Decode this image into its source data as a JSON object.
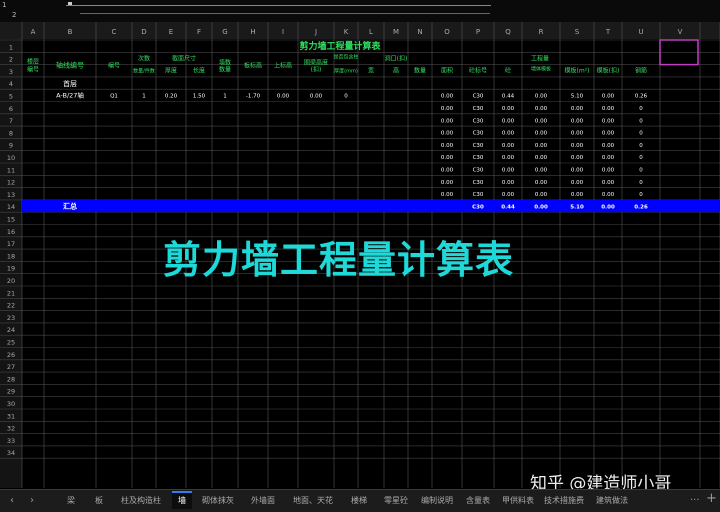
{
  "toolbar": {
    "levels": [
      "1",
      "2"
    ]
  },
  "sheet": {
    "col_letters": [
      "A",
      "B",
      "C",
      "D",
      "E",
      "F",
      "G",
      "H",
      "I",
      "J",
      "K",
      "L",
      "M",
      "N",
      "O",
      "P",
      "Q",
      "R",
      "S",
      "T",
      "U",
      "V"
    ],
    "title": "剪力墙工程量计算表",
    "headers": {
      "floor_no": "楼层编号",
      "axis_no": "轴线编号",
      "code": "编号",
      "count": "次数",
      "count_sub": "数量/件数",
      "section": "截面尺寸",
      "thick": "厚度",
      "height": "长度",
      "wall_count": "墙数/数量",
      "floor_h": "板标高",
      "top_h": "上标高",
      "ring_h": "圈梁高度(扣)",
      "misc": "是否包含柱",
      "misc_sub": "厚度(mm)",
      "opening": "洞口(扣)",
      "op_w": "宽",
      "op_h": "高",
      "op_n": "数量",
      "op_area": "面积",
      "quantities": "工程量",
      "q_grade": "砼标号",
      "q_conc": "砼",
      "q_edge": "墙体模板",
      "q_form": "模板(m²)",
      "q_form2": "模板(扣)",
      "q_rebar": "钢筋"
    },
    "floor_label": "首层",
    "rows": [
      {
        "axis": "A-B/27轴",
        "code": "Q1",
        "count": "1",
        "thick": "0.20",
        "height": "1.50",
        "wall": "1",
        "floor_h": "-1.70",
        "top_h": "0.00",
        "ring": "0.00",
        "misc": "0",
        "area": "0.00",
        "grade": "C30",
        "conc": "0.44",
        "edge": "0.00",
        "form": "5.10",
        "form2": "0.00",
        "rebar": "0.26"
      },
      {
        "area": "0.00",
        "grade": "C30",
        "conc": "0.00",
        "edge": "0.00",
        "form": "0.00",
        "form2": "0.00",
        "rebar": "0"
      },
      {
        "area": "0.00",
        "grade": "C30",
        "conc": "0.00",
        "edge": "0.00",
        "form": "0.00",
        "form2": "0.00",
        "rebar": "0"
      },
      {
        "area": "0.00",
        "grade": "C30",
        "conc": "0.00",
        "edge": "0.00",
        "form": "0.00",
        "form2": "0.00",
        "rebar": "0"
      },
      {
        "area": "0.00",
        "grade": "C30",
        "conc": "0.00",
        "edge": "0.00",
        "form": "0.00",
        "form2": "0.00",
        "rebar": "0"
      },
      {
        "area": "0.00",
        "grade": "C30",
        "conc": "0.00",
        "edge": "0.00",
        "form": "0.00",
        "form2": "0.00",
        "rebar": "0"
      },
      {
        "area": "0.00",
        "grade": "C30",
        "conc": "0.00",
        "edge": "0.00",
        "form": "0.00",
        "form2": "0.00",
        "rebar": "0"
      },
      {
        "area": "0.00",
        "grade": "C30",
        "conc": "0.00",
        "edge": "0.00",
        "form": "0.00",
        "form2": "0.00",
        "rebar": "0"
      },
      {
        "area": "0.00",
        "grade": "C30",
        "conc": "0.00",
        "edge": "0.00",
        "form": "0.00",
        "form2": "0.00",
        "rebar": "0"
      }
    ],
    "total": {
      "label": "汇总",
      "grade": "C30",
      "conc": "0.44",
      "edge": "0.00",
      "form": "5.10",
      "form2": "0.00",
      "rebar": "0.26"
    },
    "row_count": 34
  },
  "watermark": "剪力墙工程量计算表",
  "credit": "知乎 @建造师小哥",
  "tabs": [
    "梁",
    "板",
    "柱及构造柱",
    "墙",
    "砌体抹灰",
    "外墙面",
    "地面、天花",
    "楼梯",
    "零星砼",
    "编制说明",
    "含量表",
    "甲供料表",
    "技术措施费",
    "建筑做法"
  ],
  "active_tab": "墙",
  "nav": {
    "prev": "‹",
    "next": "›",
    "more": "···",
    "add": "+"
  },
  "colors": {
    "title": "#30e060",
    "header": "#30e060",
    "text": "#ffffff",
    "total_band": "#0000ff",
    "watermark": "#1fd8d8",
    "grid": "#7a7a7a"
  }
}
